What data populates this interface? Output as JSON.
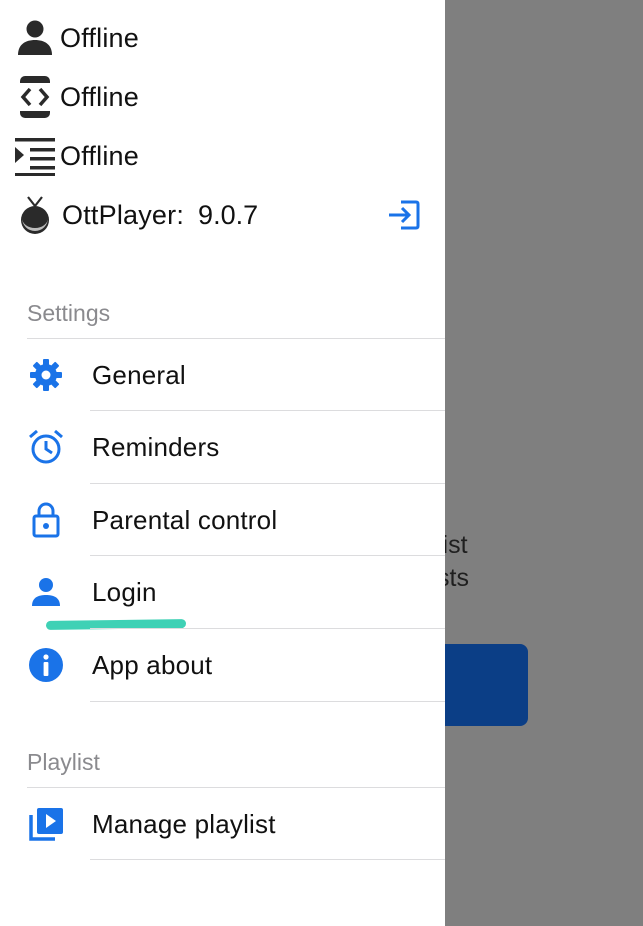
{
  "background": {
    "line1": "ect a playlist",
    "line2": "port playlists"
  },
  "status": {
    "user": "Offline",
    "device": "Offline",
    "playlist": "Offline",
    "app_name": "OttPlayer:",
    "app_version": "9.0.7"
  },
  "settings": {
    "header": "Settings",
    "items": [
      {
        "label": "General",
        "icon": "gear-icon"
      },
      {
        "label": "Reminders",
        "icon": "alarm-clock-icon"
      },
      {
        "label": "Parental control",
        "icon": "lock-icon"
      },
      {
        "label": "Login",
        "icon": "person-icon"
      },
      {
        "label": "App about",
        "icon": "info-icon"
      }
    ]
  },
  "playlist": {
    "header": "Playlist",
    "items": [
      {
        "label": "Manage playlist",
        "icon": "playlist-play-icon"
      }
    ]
  },
  "colors": {
    "accent": "#1a73e8",
    "overlay": "#7f7f7f",
    "annotation_underline": "#3fd1b5"
  }
}
